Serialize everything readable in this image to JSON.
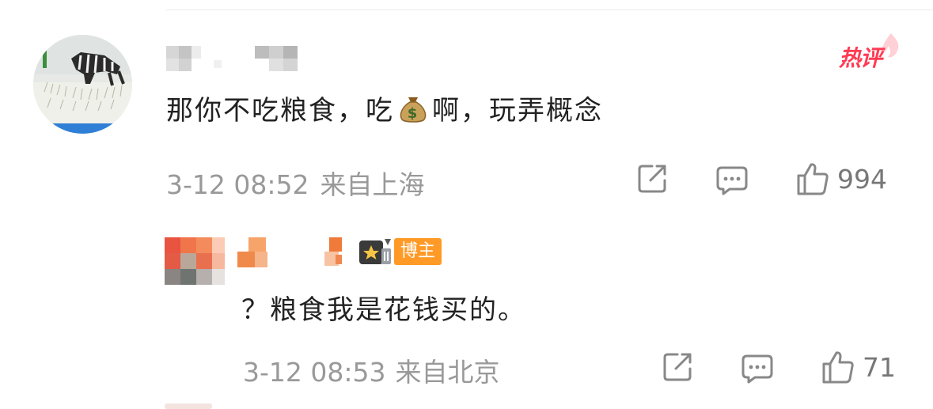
{
  "badges": {
    "hot_label": "热评",
    "creator_label": "博主"
  },
  "comment": {
    "text_before": "那你不吃粮食，吃",
    "emoji": "money-bag",
    "text_after": "啊，玩弄概念",
    "time": "3-12 08:52",
    "location": "来自上海",
    "likes": "994"
  },
  "reply": {
    "text": "？粮食我是花钱买的。",
    "time": "3-12 08:53",
    "location": "来自北京",
    "likes": "71"
  },
  "icons": {
    "share": "share-icon",
    "comment": "comment-icon",
    "like": "like-icon"
  },
  "colors": {
    "hot": "#ff3b53",
    "creator": "#ff9a26",
    "meta": "#999999",
    "text": "#222222"
  }
}
